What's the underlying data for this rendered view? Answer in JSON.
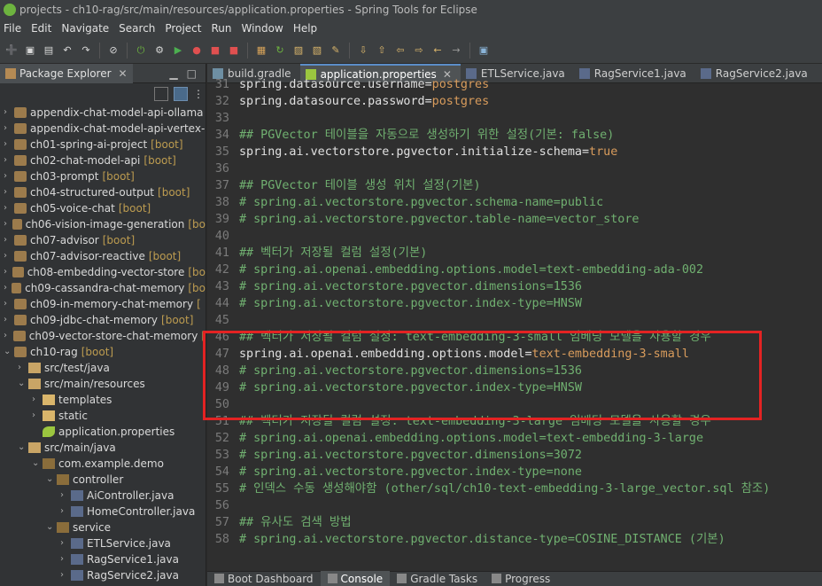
{
  "window": {
    "title": "projects - ch10-rag/src/main/resources/application.properties - Spring Tools for Eclipse"
  },
  "menu": [
    "File",
    "Edit",
    "Navigate",
    "Search",
    "Project",
    "Run",
    "Window",
    "Help"
  ],
  "explorer": {
    "tab_label": "Package Explorer",
    "items": [
      {
        "label": "appendix-chat-model-api-ollama",
        "suffix": "",
        "depth": 0,
        "arrow": ">",
        "icon": "project-icon"
      },
      {
        "label": "appendix-chat-model-api-vertex-",
        "suffix": "",
        "depth": 0,
        "arrow": ">",
        "icon": "project-icon"
      },
      {
        "label": "ch01-spring-ai-project",
        "suffix": "[boot]",
        "depth": 0,
        "arrow": ">",
        "icon": "project-icon"
      },
      {
        "label": "ch02-chat-model-api",
        "suffix": "[boot]",
        "depth": 0,
        "arrow": ">",
        "icon": "project-icon"
      },
      {
        "label": "ch03-prompt",
        "suffix": "[boot]",
        "depth": 0,
        "arrow": ">",
        "icon": "project-icon"
      },
      {
        "label": "ch04-structured-output",
        "suffix": "[boot]",
        "depth": 0,
        "arrow": ">",
        "icon": "project-icon"
      },
      {
        "label": "ch05-voice-chat",
        "suffix": "[boot]",
        "depth": 0,
        "arrow": ">",
        "icon": "project-icon"
      },
      {
        "label": "ch06-vision-image-generation",
        "suffix": "[bo",
        "depth": 0,
        "arrow": ">",
        "icon": "project-icon"
      },
      {
        "label": "ch07-advisor",
        "suffix": "[boot]",
        "depth": 0,
        "arrow": ">",
        "icon": "project-icon"
      },
      {
        "label": "ch07-advisor-reactive",
        "suffix": "[boot]",
        "depth": 0,
        "arrow": ">",
        "icon": "project-icon"
      },
      {
        "label": "ch08-embedding-vector-store",
        "suffix": "[bo",
        "depth": 0,
        "arrow": ">",
        "icon": "project-icon"
      },
      {
        "label": "ch09-cassandra-chat-memory",
        "suffix": "[bo",
        "depth": 0,
        "arrow": ">",
        "icon": "project-icon"
      },
      {
        "label": "ch09-in-memory-chat-memory",
        "suffix": "[",
        "depth": 0,
        "arrow": ">",
        "icon": "project-icon"
      },
      {
        "label": "ch09-jdbc-chat-memory",
        "suffix": "[boot]",
        "depth": 0,
        "arrow": ">",
        "icon": "project-icon"
      },
      {
        "label": "ch09-vector-store-chat-memory",
        "suffix": "[",
        "depth": 0,
        "arrow": ">",
        "icon": "project-icon"
      },
      {
        "label": "ch10-rag",
        "suffix": "[boot]",
        "depth": 0,
        "arrow": "v",
        "icon": "project-icon"
      },
      {
        "label": "src/test/java",
        "suffix": "",
        "depth": 1,
        "arrow": ">",
        "icon": "source-folder-icon"
      },
      {
        "label": "src/main/resources",
        "suffix": "",
        "depth": 1,
        "arrow": "v",
        "icon": "source-folder-icon"
      },
      {
        "label": "templates",
        "suffix": "",
        "depth": 2,
        "arrow": ">",
        "icon": "folder-icon"
      },
      {
        "label": "static",
        "suffix": "",
        "depth": 2,
        "arrow": ">",
        "icon": "folder-icon"
      },
      {
        "label": "application.properties",
        "suffix": "",
        "depth": 2,
        "arrow": "",
        "icon": "properties-file-icon"
      },
      {
        "label": "src/main/java",
        "suffix": "",
        "depth": 1,
        "arrow": "v",
        "icon": "source-folder-icon"
      },
      {
        "label": "com.example.demo",
        "suffix": "",
        "depth": 2,
        "arrow": "v",
        "icon": "package-icon"
      },
      {
        "label": "controller",
        "suffix": "",
        "depth": 3,
        "arrow": "v",
        "icon": "package-icon"
      },
      {
        "label": "AiController.java",
        "suffix": "",
        "depth": 4,
        "arrow": ">",
        "icon": "java-file-icon"
      },
      {
        "label": "HomeController.java",
        "suffix": "",
        "depth": 4,
        "arrow": ">",
        "icon": "java-file-icon"
      },
      {
        "label": "service",
        "suffix": "",
        "depth": 3,
        "arrow": "v",
        "icon": "package-icon"
      },
      {
        "label": "ETLService.java",
        "suffix": "",
        "depth": 4,
        "arrow": ">",
        "icon": "java-file-icon"
      },
      {
        "label": "RagService1.java",
        "suffix": "",
        "depth": 4,
        "arrow": ">",
        "icon": "java-file-icon"
      },
      {
        "label": "RagService2.java",
        "suffix": "",
        "depth": 4,
        "arrow": ">",
        "icon": "java-file-icon"
      }
    ]
  },
  "editor": {
    "tabs": [
      {
        "label": "build.gradle",
        "active": false,
        "closable": false
      },
      {
        "label": "application.properties",
        "active": true,
        "closable": true
      },
      {
        "label": "ETLService.java",
        "active": false,
        "closable": false
      },
      {
        "label": "RagService1.java",
        "active": false,
        "closable": false
      },
      {
        "label": "RagService2.java",
        "active": false,
        "closable": false
      }
    ],
    "lines": [
      {
        "n": "31",
        "type": "kv",
        "key": "spring.datasource.username=",
        "value": "postgres"
      },
      {
        "n": "32",
        "type": "kv",
        "key": "spring.datasource.password=",
        "value": "postgres"
      },
      {
        "n": "33",
        "type": "blank",
        "text": ""
      },
      {
        "n": "34",
        "type": "comment",
        "text": "## PGVector 테이블을 자동으로 생성하기 위한 설정(기본: false)"
      },
      {
        "n": "35",
        "type": "kv",
        "key": "spring.ai.vectorstore.pgvector.initialize-schema=",
        "value": "true"
      },
      {
        "n": "36",
        "type": "blank",
        "text": ""
      },
      {
        "n": "37",
        "type": "comment",
        "text": "## PGVector 테이블 생성 위치 설정(기본)"
      },
      {
        "n": "38",
        "type": "comment",
        "text": "# spring.ai.vectorstore.pgvector.schema-name=public"
      },
      {
        "n": "39",
        "type": "comment",
        "text": "# spring.ai.vectorstore.pgvector.table-name=vector_store"
      },
      {
        "n": "40",
        "type": "blank",
        "text": ""
      },
      {
        "n": "41",
        "type": "comment",
        "text": "## 벡터가 저장될 컬럼 설정(기본)"
      },
      {
        "n": "42",
        "type": "comment",
        "text": "# spring.ai.openai.embedding.options.model=text-embedding-ada-002"
      },
      {
        "n": "43",
        "type": "comment",
        "text": "# spring.ai.vectorstore.pgvector.dimensions=1536"
      },
      {
        "n": "44",
        "type": "comment",
        "text": "# spring.ai.vectorstore.pgvector.index-type=HNSW"
      },
      {
        "n": "45",
        "type": "blank",
        "text": ""
      },
      {
        "n": "46",
        "type": "comment",
        "text": "## 벡터가 저장될 컬럼 설정: text-embedding-3-small 임베딩 모델을 사용할 경우"
      },
      {
        "n": "47",
        "type": "kv",
        "key": "spring.ai.openai.embedding.options.model=",
        "value": "text-embedding-3-small"
      },
      {
        "n": "48",
        "type": "comment",
        "text": "# spring.ai.vectorstore.pgvector.dimensions=1536"
      },
      {
        "n": "49",
        "type": "comment",
        "text": "# spring.ai.vectorstore.pgvector.index-type=HNSW"
      },
      {
        "n": "50",
        "type": "blank",
        "text": ""
      },
      {
        "n": "51",
        "type": "comment",
        "text": "## 벡터가 저장될 컬럼 설정: text-embedding-3-large 임베딩 모델을 사용할 경우"
      },
      {
        "n": "52",
        "type": "comment",
        "text": "# spring.ai.openai.embedding.options.model=text-embedding-3-large"
      },
      {
        "n": "53",
        "type": "comment",
        "text": "# spring.ai.vectorstore.pgvector.dimensions=3072"
      },
      {
        "n": "54",
        "type": "comment",
        "text": "# spring.ai.vectorstore.pgvector.index-type=none"
      },
      {
        "n": "55",
        "type": "comment",
        "text": "# 인덱스 수동 생성해야함 (other/sql/ch10-text-embedding-3-large_vector.sql 참조)"
      },
      {
        "n": "56",
        "type": "blank",
        "text": ""
      },
      {
        "n": "57",
        "type": "comment",
        "text": "## 유사도 검색 방법"
      },
      {
        "n": "58",
        "type": "comment",
        "text": "# spring.ai.vectorstore.pgvector.distance-type=COSINE_DISTANCE (기본)"
      }
    ]
  },
  "bottom_tabs": [
    {
      "label": "Boot Dashboard",
      "active": false
    },
    {
      "label": "Console",
      "active": true
    },
    {
      "label": "Gradle Tasks",
      "active": false
    },
    {
      "label": "Progress",
      "active": false
    }
  ],
  "colors": {
    "highlight_border": "#e32323",
    "comment": "#70b070",
    "value": "#d99c5c",
    "boot_tag": "#bd9c50"
  }
}
